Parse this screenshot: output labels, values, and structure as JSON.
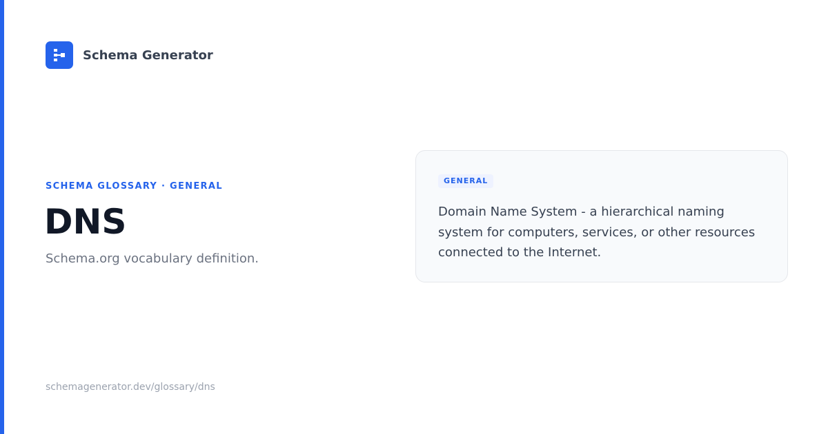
{
  "brand": {
    "name": "Schema Generator",
    "logo_icon": "sitemap-icon"
  },
  "colors": {
    "accent": "#2563eb",
    "title": "#111827",
    "muted": "#6b7280",
    "card_background": "#f8fafc"
  },
  "eyebrow": "SCHEMA GLOSSARY · GENERAL",
  "title": "DNS",
  "subtitle": "Schema.org vocabulary definition.",
  "card": {
    "badge": "GENERAL",
    "definition": "Domain Name System - a hierarchical naming system for computers, services, or other resources connected to the Internet."
  },
  "footer": {
    "url": "schemagenerator.dev/glossary/dns"
  }
}
